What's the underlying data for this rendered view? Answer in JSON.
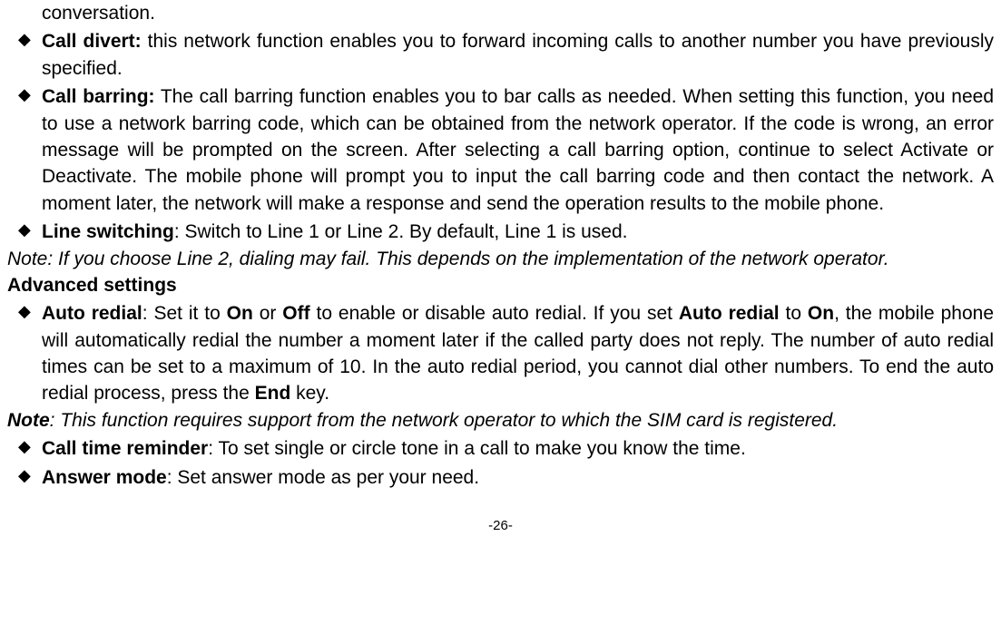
{
  "lines": {
    "conversation": "conversation.",
    "callDivert": {
      "label": "Call divert:",
      "text": " this network function enables you to forward incoming calls to another number you have previously specified."
    },
    "callBarring": {
      "label": "Call barring:",
      "text": " The call barring function enables you to bar calls as needed. When setting this function, you need to use a network barring code, which can be obtained from the network operator. If the code is wrong, an error message will be prompted on the screen. After selecting a call barring option, continue to select Activate or Deactivate. The mobile phone will prompt you to input the call barring code and then contact the network. A moment later, the network will make a response and send the operation results to the mobile phone."
    },
    "lineSwitching": {
      "label": "Line switching",
      "text": ": Switch to Line 1 or Line 2. By default, Line 1 is used."
    },
    "note1": "Note: If you choose Line 2, dialing may fail. This depends on the implementation of the network operator.",
    "advancedHeading": "Advanced settings",
    "autoRedial": {
      "label": "Auto redial",
      "t1": ": Set it to ",
      "b1": "On",
      "t2": " or ",
      "b2": "Off",
      "t3": " to enable or disable auto redial. If you set ",
      "b3": "Auto redial",
      "t4": " to ",
      "b4": "On",
      "t5": ", the mobile phone will automatically redial the number a moment later if the called party does not reply. The number of auto redial times can be set to a maximum of 10. In the auto redial period, you cannot dial other numbers. To end the auto redial process, press the ",
      "b5": "End",
      "t6": " key."
    },
    "note2label": "Note",
    "note2text": ": This function requires support from the network operator to which the SIM card is registered.",
    "callTimeReminder": {
      "label": "Call time reminder",
      "text": ": To set single or circle tone in a call to make you know the time."
    },
    "answerMode": {
      "label": "Answer mode",
      "text": ": Set answer mode as per your need."
    }
  },
  "pageNum": "-26-"
}
